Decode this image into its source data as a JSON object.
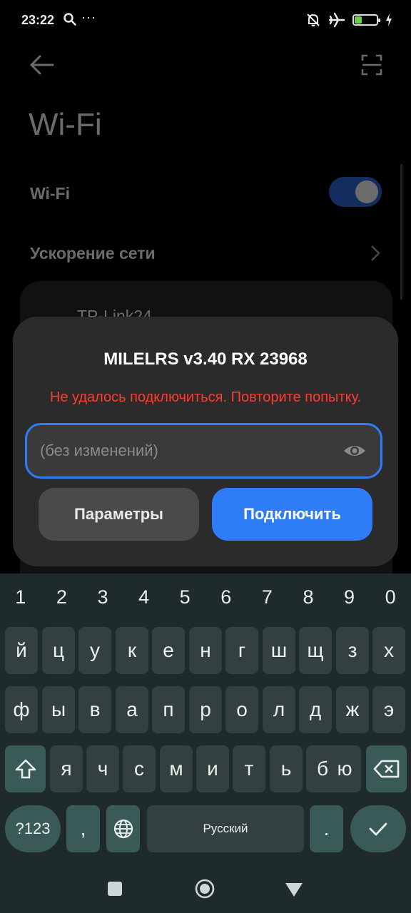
{
  "status_bar": {
    "time": "23:22",
    "more": "···",
    "battery_level": "30",
    "battery_fraction": 0.3,
    "icons": [
      "search-icon",
      "silent-bell-icon",
      "airplane-icon",
      "battery-icon",
      "charging-icon"
    ]
  },
  "settings": {
    "title": "Wi-Fi",
    "wifi_label": "Wi-Fi",
    "wifi_enabled": true,
    "boost_label": "Ускорение сети",
    "network_partial": "TP-Link24"
  },
  "dialog": {
    "title": "MILELRS v3.40 RX 23968",
    "error": "Не удалось подключиться. Повторите попытку.",
    "password_placeholder": "(без изменений)",
    "password_value": "",
    "params_button": "Параметры",
    "connect_button": "Подключить"
  },
  "keyboard": {
    "numbers": [
      "1",
      "2",
      "3",
      "4",
      "5",
      "6",
      "7",
      "8",
      "9",
      "0"
    ],
    "row1": [
      "й",
      "ц",
      "у",
      "к",
      "е",
      "н",
      "г",
      "ш",
      "щ",
      "з",
      "х"
    ],
    "row2": [
      "ф",
      "ы",
      "в",
      "а",
      "п",
      "р",
      "о",
      "л",
      "д",
      "ж",
      "э"
    ],
    "row3": [
      "я",
      "ч",
      "с",
      "м",
      "и",
      "т",
      "ь",
      "б",
      "ю"
    ],
    "symbols_key": "?123",
    "comma_key": ",",
    "space_label": "Русский",
    "period_key": "."
  },
  "colors": {
    "accent": "#2f7df6",
    "error": "#ff3b30",
    "dialog_bg": "#2b2b2b",
    "keyboard_bg": "#1f2b2b"
  }
}
